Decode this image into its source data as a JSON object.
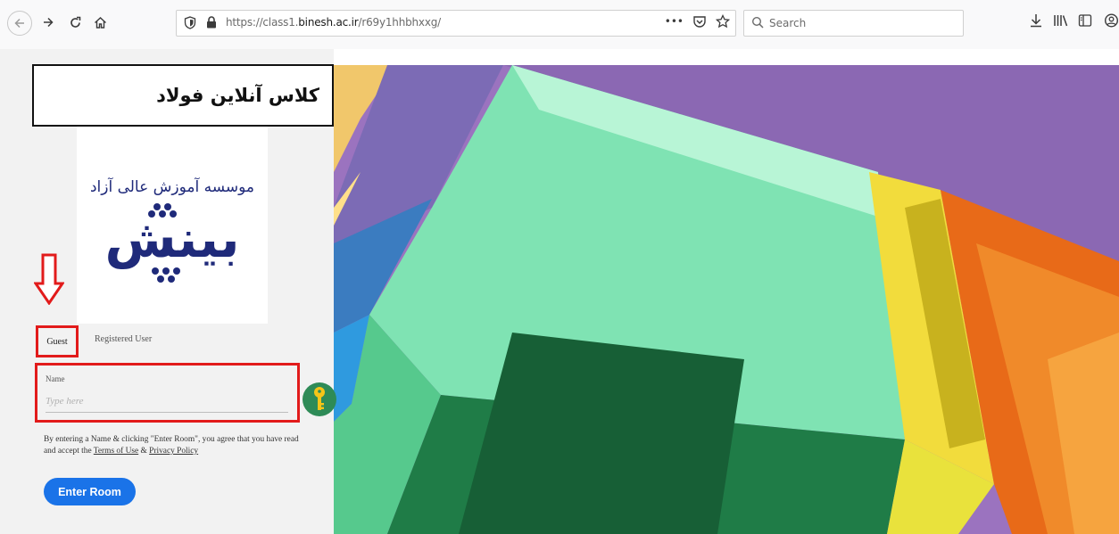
{
  "browser": {
    "url_prefix": "https://class1.",
    "url_host": "binesh.ac.ir",
    "url_path": "/r69y1hhbhxxg/",
    "search_placeholder": "Search",
    "overflow_label": "•••"
  },
  "page": {
    "title": "کلاس آنلاین فولاد",
    "logo_caption": "موسسه آموزش عالی آزاد",
    "logo_wordmark": "بینش",
    "tabs": [
      "Guest",
      "Registered User"
    ],
    "name_label": "Name",
    "name_placeholder": "Type here",
    "terms_prefix": "By entering a Name & clicking \"Enter Room\", you agree that you have read and accept the ",
    "terms_link": "Terms of Use",
    "terms_and": " & ",
    "privacy_link": "Privacy Policy",
    "enter_button": "Enter Room"
  },
  "colors": {
    "highlight": "#e21b1b",
    "enter_button": "#1a73e8",
    "key_button": "#2e8b57",
    "logo_blue": "#1f2a7a"
  }
}
